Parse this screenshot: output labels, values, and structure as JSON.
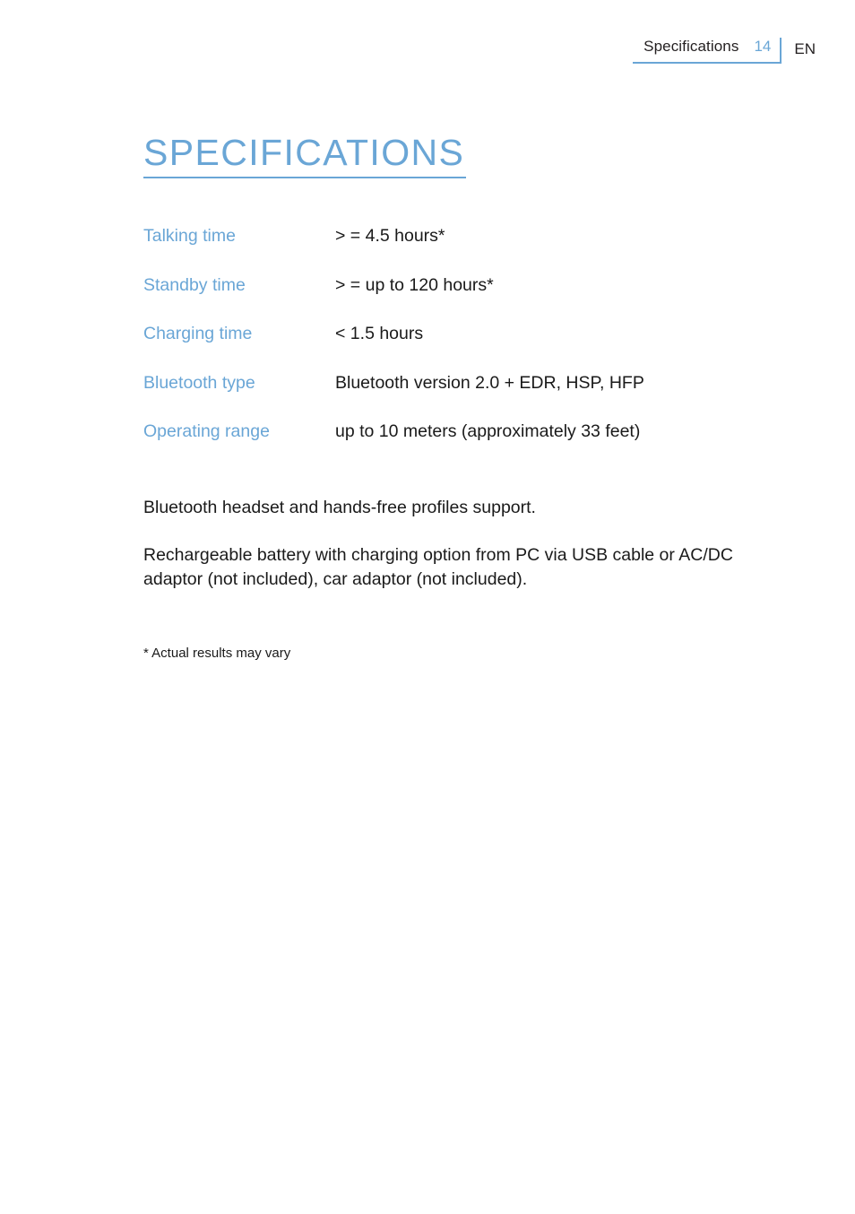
{
  "header": {
    "section": "Specifications",
    "page_number": "14",
    "language": "EN",
    "rule_color": "#6aa6d6"
  },
  "title": {
    "text": "SPECIFICATIONS",
    "color": "#6aa6d6"
  },
  "specs": {
    "label_color": "#6aa6d6",
    "value_color": "#1a1a1a",
    "rows": [
      {
        "label": "Talking time",
        "value": "> = 4.5 hours*"
      },
      {
        "label": "Standby time",
        "value": "> = up to 120 hours*"
      },
      {
        "label": "Charging time",
        "value": "< 1.5 hours"
      },
      {
        "label": "Bluetooth type",
        "value": "Bluetooth version 2.0 + EDR, HSP, HFP"
      },
      {
        "label": "Operating range",
        "value": "up to 10 meters (approximately 33 feet)"
      }
    ]
  },
  "body": {
    "paragraphs": [
      "Bluetooth headset and hands-free profiles support.",
      "Rechargeable battery with charging option from PC via USB cable or AC/DC adaptor (not included), car adaptor (not included)."
    ]
  },
  "footnote": "* Actual results may vary"
}
